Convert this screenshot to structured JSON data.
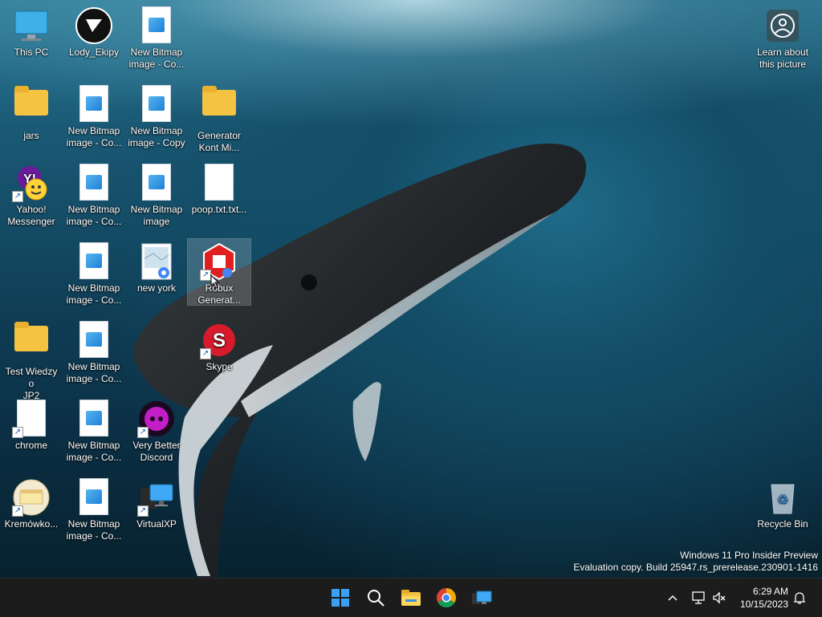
{
  "desktop": {
    "learn_more": "Learn about\nthis picture",
    "icons": {
      "this_pc": "This PC",
      "lody_ekipy": "Lody_Ekipy",
      "nb_r0c2": "New Bitmap\nimage - Co...",
      "jars": "jars",
      "nb_r1c1": "New Bitmap\nimage - Co...",
      "nb_r1c2": "New Bitmap\nimage - Copy",
      "generator": "Generator\nKont Mi...",
      "yahoo": "Yahoo!\nMessenger",
      "nb_r2c1": "New Bitmap\nimage - Co...",
      "nb_r2c2": "New Bitmap\nimage",
      "poop": "poop.txt.txt...",
      "nb_r3c1": "New Bitmap\nimage - Co...",
      "new_york": "new york",
      "robux": "Robux\nGenerat...",
      "test_wiedzy": "Test Wiedzy o\nJP2",
      "nb_r4c1": "New Bitmap\nimage - Co...",
      "skype": "Skype",
      "chrome": "chrome",
      "nb_r5c1": "New Bitmap\nimage - Co...",
      "very_better_discord": "Very Better\nDiscord",
      "kremowko": "Kremówko...",
      "nb_r6c1": "New Bitmap\nimage - Co...",
      "virtualxp": "VirtualXP",
      "recycle_bin": "Recycle Bin"
    }
  },
  "watermark": {
    "line1": "Windows 11 Pro Insider Preview",
    "line2": "Evaluation copy. Build 25947.rs_prerelease.230901-1416"
  },
  "taskbar": {
    "time": "6:29 AM",
    "date": "10/15/2023"
  },
  "colors": {
    "taskbar_bg": "#1c1c1c",
    "start_blue": "#3aa0f3",
    "folder_yellow": "#f5c342"
  }
}
